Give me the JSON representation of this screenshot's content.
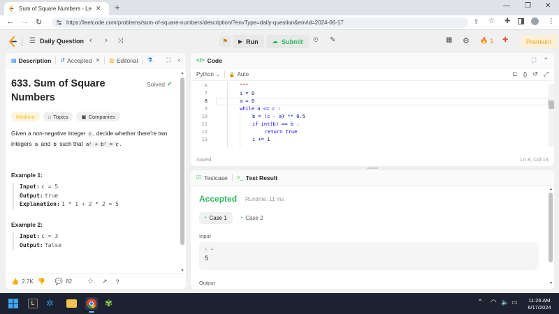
{
  "browser": {
    "tab_title": "Sum of Square Numbers - LeetC",
    "url": "https://leetcode.com/problems/sum-of-square-numbers/description/?envType=daily-question&envId=2024-06-17"
  },
  "header": {
    "daily_label": "Daily Question",
    "run_label": "Run",
    "submit_label": "Submit",
    "streak": "1",
    "premium_label": "Premium"
  },
  "left": {
    "tabs": [
      "Description",
      "Accepted",
      "Editorial"
    ],
    "title": "633. Sum of Square Numbers",
    "solved": "Solved",
    "difficulty": "Medium",
    "topics": "Topics",
    "companies": "Companies",
    "desc_pre": "Given a non-negative integer",
    "desc_c": "c",
    "desc_mid": ", decide whether there're two integers",
    "desc_a": "a",
    "desc_and": "and",
    "desc_b": "b",
    "desc_such": "such that",
    "desc_eq": "a² + b² = c",
    "desc_end": ".",
    "ex1_title": "Example 1:",
    "ex1_input_label": "Input:",
    "ex1_input": "c = 5",
    "ex1_output_label": "Output:",
    "ex1_output": "true",
    "ex1_expl_label": "Explanation:",
    "ex1_expl": "1 * 1 + 2 * 2 = 5",
    "ex2_title": "Example 2:",
    "ex2_input_label": "Input:",
    "ex2_input": "c = 3",
    "ex2_output_label": "Output:",
    "ex2_output": "false",
    "likes": "2.7K",
    "comments": "82"
  },
  "code": {
    "tab": "Code",
    "language": "Python",
    "auto": "Auto",
    "saved": "Saved",
    "cursor": "Ln 8, Col 14",
    "lines": [
      {
        "n": "6",
        "text": "\"\"\""
      },
      {
        "n": "7",
        "text": "i = 0"
      },
      {
        "n": "8",
        "text": "a = 0"
      },
      {
        "n": "9",
        "text": "while a <= c :"
      },
      {
        "n": "10",
        "text": "b = (c - a) ** 0.5"
      },
      {
        "n": "11",
        "text": "if int(b) == b :"
      },
      {
        "n": "12",
        "text": "return True"
      },
      {
        "n": "13",
        "text": "i += 1"
      }
    ]
  },
  "result": {
    "tab_testcase": "Testcase",
    "tab_result": "Test Result",
    "status": "Accepted",
    "runtime": "Runtime: 11 ms",
    "case1": "Case 1",
    "case2": "Case 2",
    "input_label": "Input",
    "var_name": "c =",
    "var_value": "5",
    "output_label": "Output"
  },
  "taskbar": {
    "time": "11:26 AM",
    "date": "6/17/2024"
  },
  "colors": {
    "accepted": "#2cbb5d",
    "medium": "#ffb800",
    "accent": "#ffa116"
  }
}
